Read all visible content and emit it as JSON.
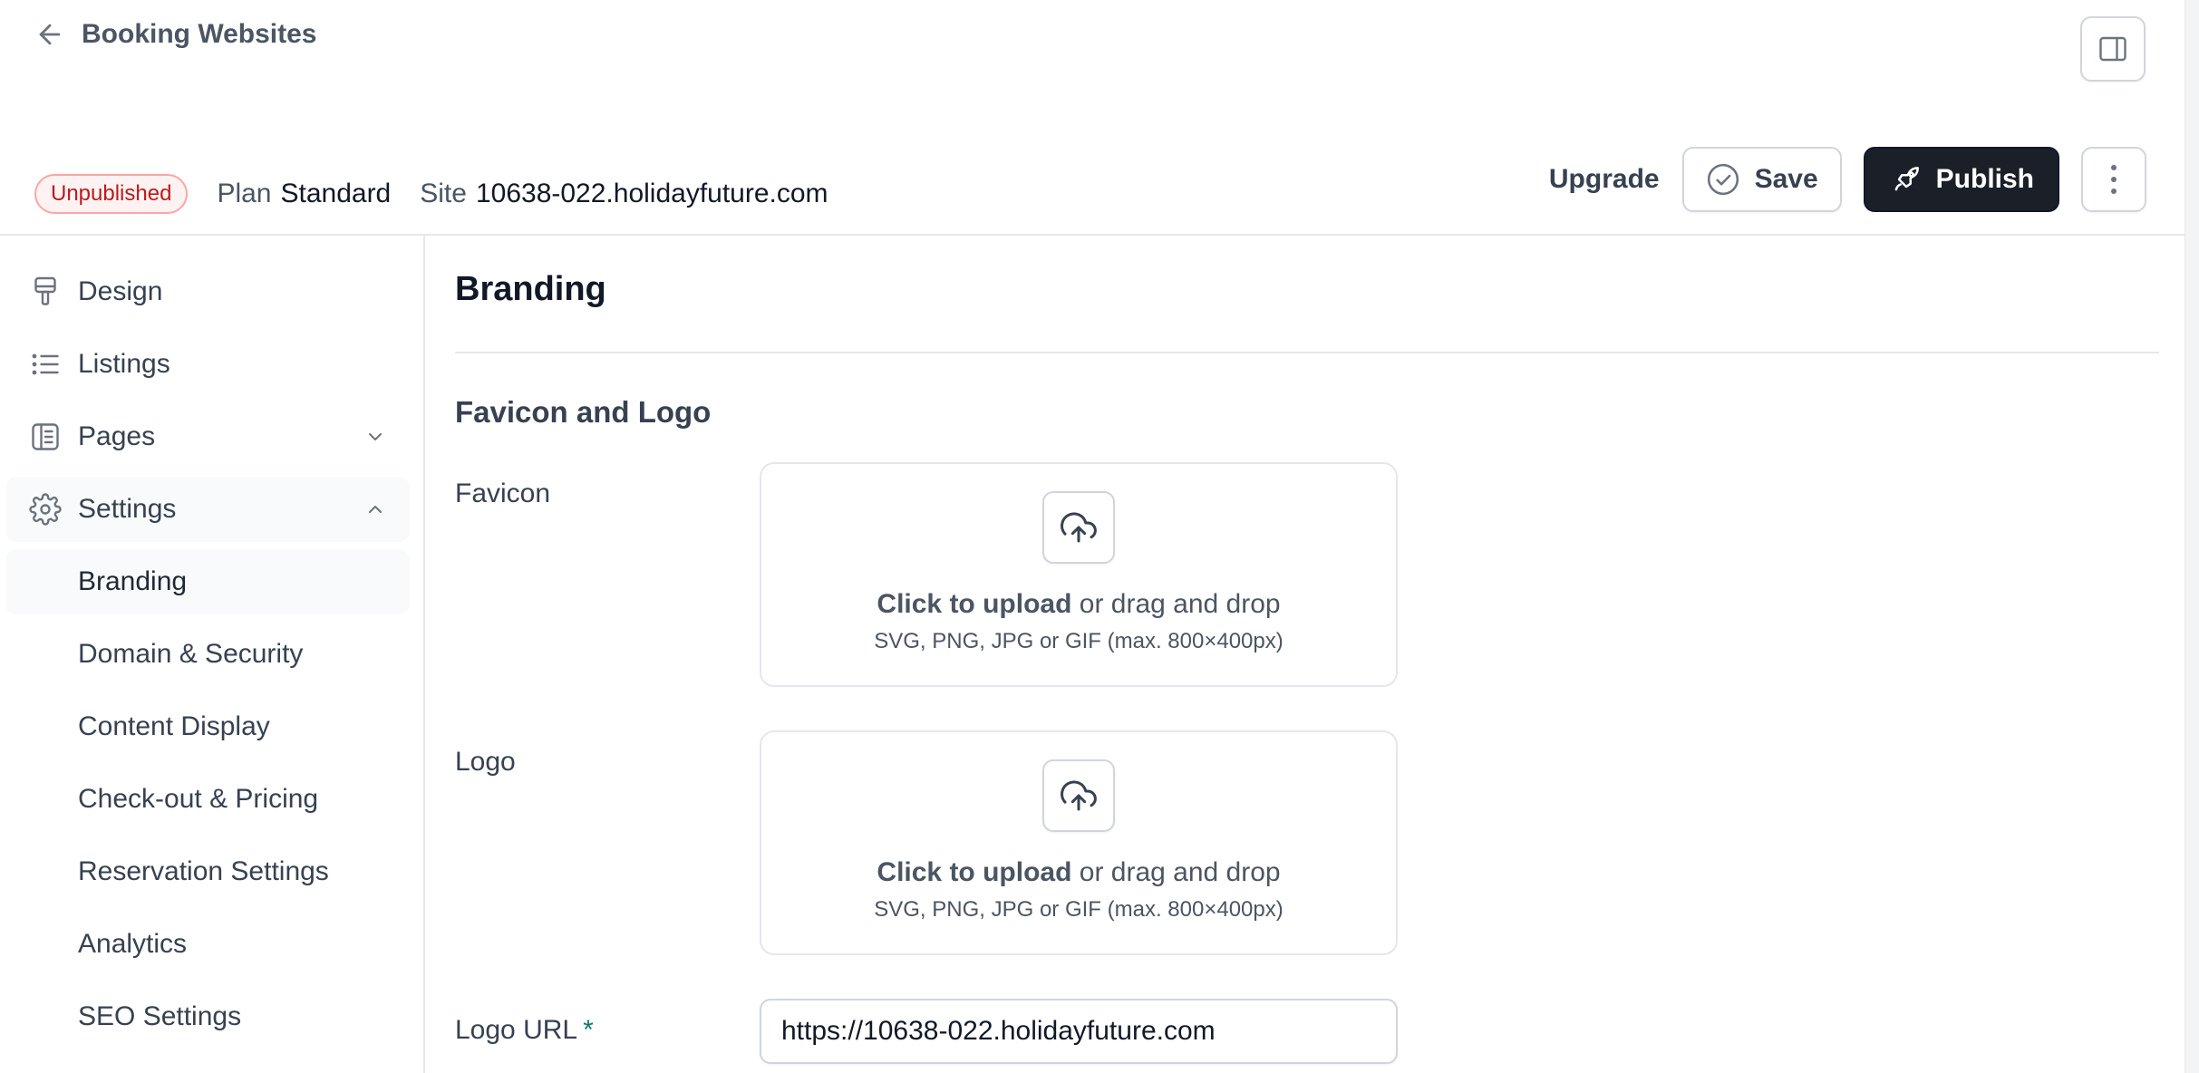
{
  "header": {
    "back_label": "Booking Websites",
    "status_badge": "Unpublished",
    "plan_label": "Plan",
    "plan_value": "Standard",
    "site_label": "Site",
    "site_value": "10638-022.holidayfuture.com",
    "upgrade_label": "Upgrade",
    "save_label": "Save",
    "publish_label": "Publish"
  },
  "sidebar": {
    "items": [
      {
        "label": "Design",
        "icon": "paint-roller-icon"
      },
      {
        "label": "Listings",
        "icon": "list-icon"
      },
      {
        "label": "Pages",
        "icon": "book-icon",
        "expanded": false
      },
      {
        "label": "Settings",
        "icon": "gear-icon",
        "expanded": true
      }
    ],
    "settings_children": [
      "Branding",
      "Domain & Security",
      "Content Display",
      "Check-out & Pricing",
      "Reservation Settings",
      "Analytics",
      "SEO Settings"
    ],
    "active": "Branding"
  },
  "main": {
    "title": "Branding",
    "section_title": "Favicon and Logo",
    "favicon_label": "Favicon",
    "logo_label": "Logo",
    "upload_strong": "Click to upload",
    "upload_rest": " or drag and drop",
    "upload_hint": "SVG, PNG, JPG or GIF (max. 800×400px)",
    "logo_url_label": "Logo URL",
    "required_mark": "*",
    "logo_url_value": "https://10638-022.holidayfuture.com"
  },
  "colors": {
    "publish_bg": "#1b1f27",
    "badge_border": "#fca5a5",
    "badge_text": "#b91c1c",
    "required": "#0f766e"
  }
}
